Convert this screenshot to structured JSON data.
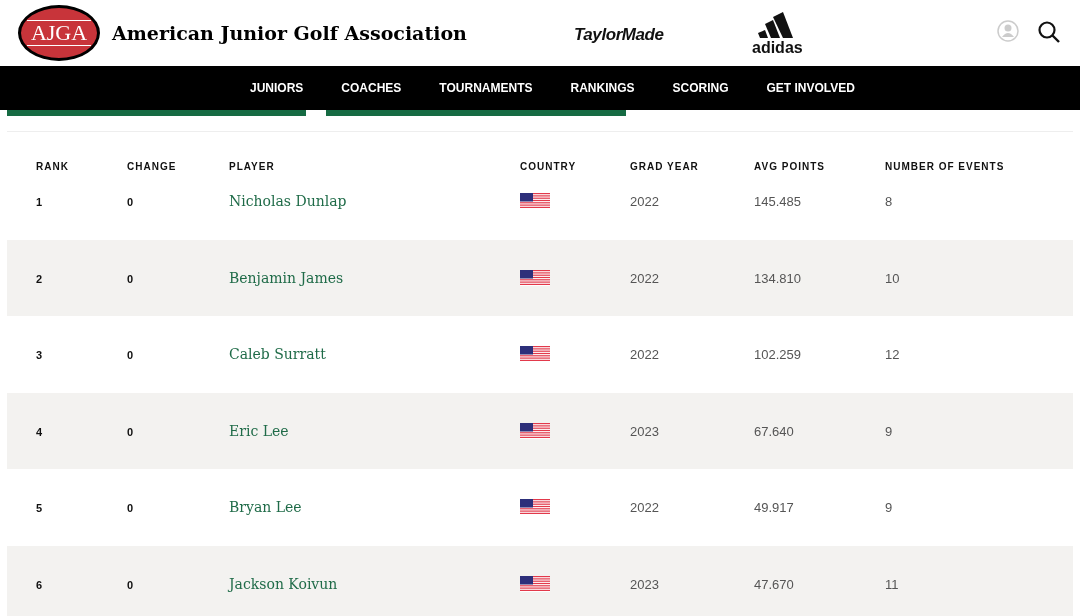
{
  "header": {
    "logo_text": "AJGA",
    "title": "American Junior Golf Association",
    "sponsors": [
      "TaylorMade",
      "adidas"
    ]
  },
  "nav": [
    "JUNIORS",
    "COACHES",
    "TOURNAMENTS",
    "RANKINGS",
    "SCORING",
    "GET INVOLVED"
  ],
  "table": {
    "columns": [
      "RANK",
      "CHANGE",
      "PLAYER",
      "COUNTRY",
      "GRAD YEAR",
      "AVG POINTS",
      "NUMBER OF EVENTS"
    ],
    "rows": [
      {
        "rank": "1",
        "change": "0",
        "player": "Nicholas Dunlap",
        "grad_year": "2022",
        "avg_points": "145.485",
        "events": "8"
      },
      {
        "rank": "2",
        "change": "0",
        "player": "Benjamin James",
        "grad_year": "2022",
        "avg_points": "134.810",
        "events": "10"
      },
      {
        "rank": "3",
        "change": "0",
        "player": "Caleb Surratt",
        "grad_year": "2022",
        "avg_points": "102.259",
        "events": "12"
      },
      {
        "rank": "4",
        "change": "0",
        "player": "Eric Lee",
        "grad_year": "2023",
        "avg_points": "67.640",
        "events": "9"
      },
      {
        "rank": "5",
        "change": "0",
        "player": "Bryan Lee",
        "grad_year": "2022",
        "avg_points": "49.917",
        "events": "9"
      },
      {
        "rank": "6",
        "change": "0",
        "player": "Jackson Koivun",
        "grad_year": "2023",
        "avg_points": "47.670",
        "events": "11"
      }
    ]
  }
}
